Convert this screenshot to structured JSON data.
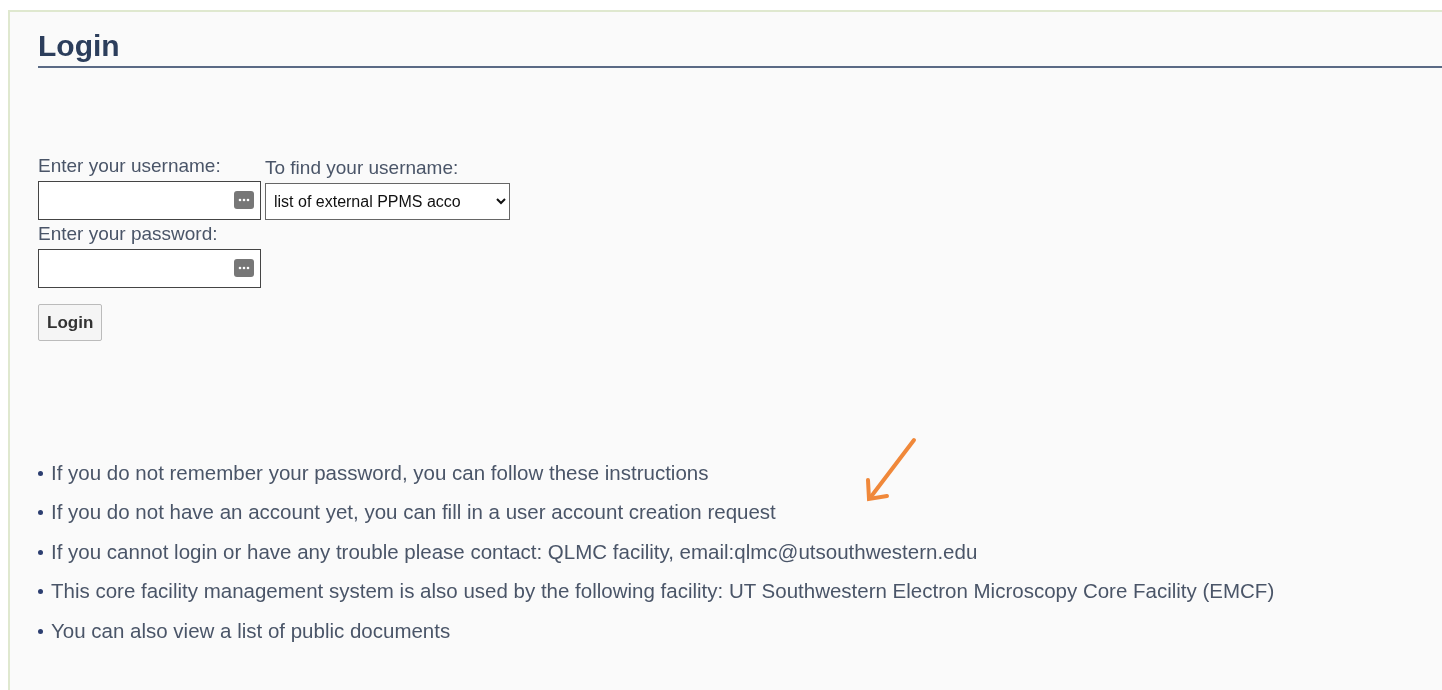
{
  "title": "Login",
  "username": {
    "label": "Enter your username:"
  },
  "find_username": {
    "label": "To find your username:",
    "value": "list of external PPMS acco"
  },
  "password": {
    "label": "Enter your password:"
  },
  "login_button": "Login",
  "info": [
    {
      "text": "If you do not remember your password, you can follow these instructions"
    },
    {
      "text": "If you do not have an account yet, you can fill in a user account creation request"
    },
    {
      "text": "If you cannot login or have any trouble please contact: QLMC facility, email:qlmc@utsouthwestern.edu"
    },
    {
      "text": "This core facility management system is also used by the following facility: UT Southwestern Electron Microscopy Core Facility (EMCF)"
    },
    {
      "text": "You can also view a list of public documents"
    }
  ]
}
